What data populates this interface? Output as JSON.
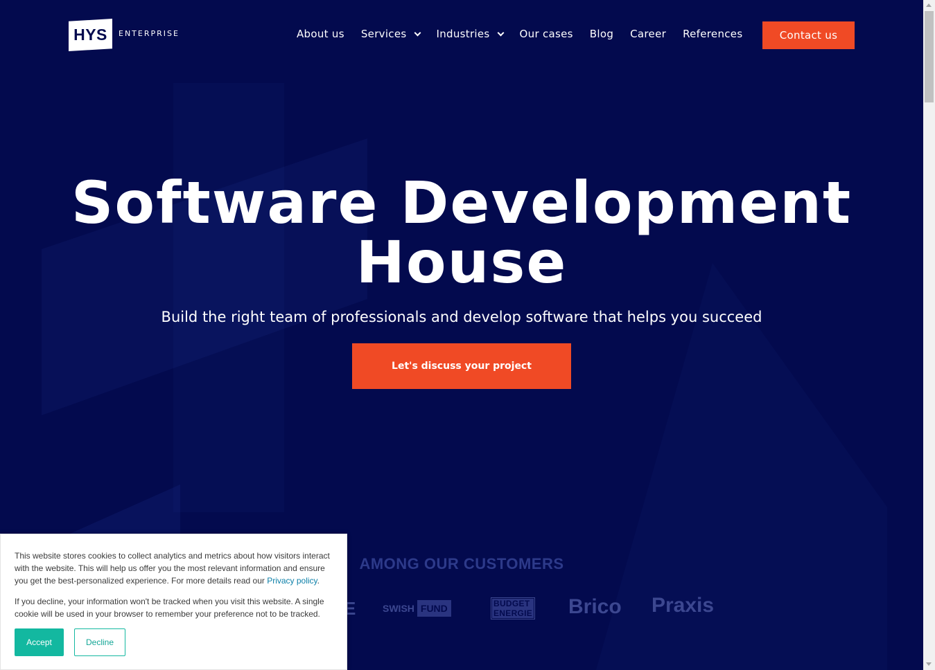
{
  "header": {
    "logo_mark": "HYS",
    "logo_text": "ENTERPRISE",
    "nav": [
      {
        "label": "About us",
        "has_dropdown": false
      },
      {
        "label": "Services",
        "has_dropdown": true
      },
      {
        "label": "Industries",
        "has_dropdown": true
      },
      {
        "label": "Our cases",
        "has_dropdown": false
      },
      {
        "label": "Blog",
        "has_dropdown": false
      },
      {
        "label": "Career",
        "has_dropdown": false
      },
      {
        "label": "References",
        "has_dropdown": false
      }
    ],
    "contact_label": "Contact us"
  },
  "hero": {
    "title_line1": "Software Development",
    "title_line2": "House",
    "subtitle": "Build the right team of professionals and develop software that helps you succeed",
    "cta_label": "Let's discuss your project"
  },
  "customers": {
    "title": "AMONG OUR CUSTOMERS",
    "logos": {
      "partial": "E",
      "swish": "SWISH",
      "fund": "FUND",
      "budget_line1": "BUDGET",
      "budget_line2": "ENERGIE",
      "brico": "Brico",
      "praxis": "Praxis"
    }
  },
  "cookie": {
    "text1": "This website stores cookies to collect analytics and metrics about how visitors interact with the website. This will help us offer you the most relevant information and ensure you get the best-personalized experience. For more details read our ",
    "privacy_link": "Privacy policy",
    "text1_end": ".",
    "text2": "If you decline, your information won't be tracked when you visit this website. A single cookie will be used in your browser to remember your preference not to be tracked.",
    "accept_label": "Accept",
    "decline_label": "Decline"
  },
  "colors": {
    "background": "#030a4e",
    "accent": "#f04a25",
    "cookie_accent": "#13b8a0"
  }
}
